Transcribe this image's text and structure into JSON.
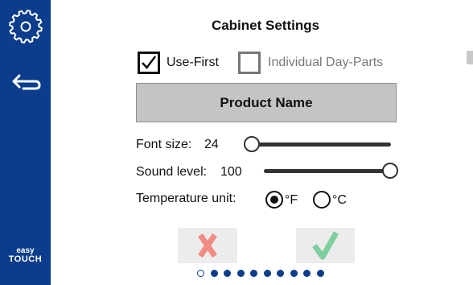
{
  "sidebar": {
    "settings_icon": "gear-icon",
    "back_icon": "back-arrow-icon",
    "brand_line1": "easy",
    "brand_line2": "TOUCH",
    "background_color": "#0b3d8c"
  },
  "title": "Cabinet Settings",
  "options": {
    "use_first": {
      "label": "Use-First",
      "checked": true
    },
    "individual_day_parts": {
      "label": "Individual Day-Parts",
      "checked": false
    }
  },
  "product_button": {
    "label": "Product Name"
  },
  "font_size": {
    "label": "Font size:",
    "value": "24",
    "slider_fraction": 0.0
  },
  "sound_level": {
    "label": "Sound level:",
    "value": "100",
    "slider_fraction": 1.0
  },
  "temperature_unit": {
    "label": "Temperature unit:",
    "options": [
      {
        "label": "°F",
        "selected": true
      },
      {
        "label": "°C",
        "selected": false
      }
    ]
  },
  "actions": {
    "cancel_icon": "x-icon",
    "cancel_color": "#f08c84",
    "confirm_icon": "checkmark-icon",
    "confirm_color": "#7ecf9f"
  },
  "pagination": {
    "total": 10,
    "current": 1
  }
}
